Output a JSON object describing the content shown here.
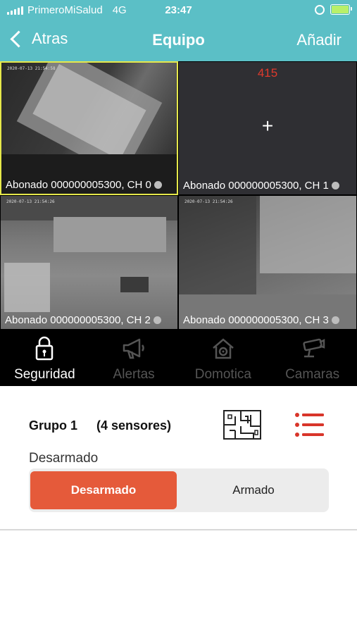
{
  "status_bar": {
    "carrier": "PrimeroMiSalud",
    "network": "4G",
    "time": "23:47"
  },
  "nav": {
    "back_label": "Atras",
    "title": "Equipo",
    "add_label": "Añadir"
  },
  "cameras": [
    {
      "label": "Abonado 000000005300, CH 0",
      "timestamp": "2020-07-13 21:54:58"
    },
    {
      "label": "Abonado 000000005300, CH 1",
      "number": "415",
      "placeholder": "+"
    },
    {
      "label": "Abonado 000000005300, CH 2",
      "timestamp": "2020-07-13 21:54:26"
    },
    {
      "label": "Abonado 000000005300, CH 3",
      "timestamp": "2020-07-13 21:54:26"
    }
  ],
  "tabs": [
    {
      "label": "Seguridad",
      "icon": "lock-icon",
      "active": true
    },
    {
      "label": "Alertas",
      "icon": "megaphone-icon",
      "active": false
    },
    {
      "label": "Domotica",
      "icon": "smart-home-icon",
      "active": false
    },
    {
      "label": "Camaras",
      "icon": "camera-icon",
      "active": false
    }
  ],
  "group": {
    "name": "Grupo 1",
    "sensor_count": "(4 sensores)",
    "status": "Desarmado",
    "options": [
      "Desarmado",
      "Armado"
    ],
    "selected": "Desarmado"
  },
  "colors": {
    "header": "#5bbfc6",
    "accent": "#e55a3a",
    "tab_bar": "#000000",
    "active_border": "#e6e84a"
  }
}
